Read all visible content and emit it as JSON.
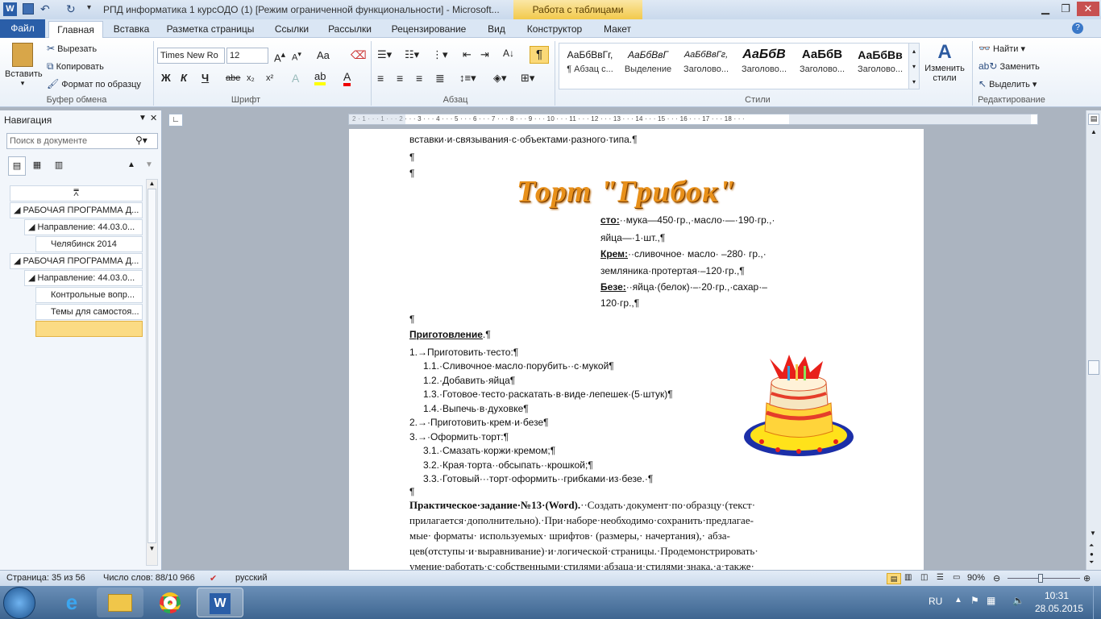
{
  "titlebar": {
    "title": "РПД информатика 1 курсОДО (1) [Режим ограниченной функциональности]  -  Microsoft...",
    "context_tab": "Работа с таблицами"
  },
  "tabs": [
    "Файл",
    "Главная",
    "Вставка",
    "Разметка страницы",
    "Ссылки",
    "Рассылки",
    "Рецензирование",
    "Вид",
    "Конструктор",
    "Макет"
  ],
  "ribbon": {
    "clipboard": {
      "paste": "Вставить",
      "cut": "Вырезать",
      "copy": "Копировать",
      "format_painter": "Формат по образцу",
      "label": "Буфер обмена"
    },
    "font": {
      "name": "Times New Ro",
      "size": "12",
      "label": "Шрифт",
      "bold": "Ж",
      "italic": "К",
      "underline": "Ч",
      "strike": "abe",
      "sub": "x₂",
      "sup": "x²",
      "case": "Aa"
    },
    "paragraph": {
      "label": "Абзац",
      "pilcrow": "¶"
    },
    "styles": {
      "label": "Стили",
      "items": [
        {
          "sample": "АаБбВвГг,",
          "name": "¶ Абзац с..."
        },
        {
          "sample": "АаБбВвГ",
          "name": "Выделение"
        },
        {
          "sample": "АаБбВвГг,",
          "name": "Заголово..."
        },
        {
          "sample": "АаБбВ",
          "name": "Заголово..."
        },
        {
          "sample": "АаБбВ",
          "name": "Заголово..."
        },
        {
          "sample": "АаБбВв",
          "name": "Заголово..."
        }
      ],
      "change": "Изменить стили"
    },
    "editing": {
      "find": "Найти",
      "replace": "Заменить",
      "select": "Выделить",
      "label": "Редактирование"
    }
  },
  "nav": {
    "title": "Навигация",
    "search_placeholder": "Поиск в документе",
    "items": [
      "РАБОЧАЯ ПРОГРАММА Д...",
      "Направление: 44.03.0...",
      "Челябинск 2014",
      "РАБОЧАЯ ПРОГРАММА Д...",
      "Направление: 44.03.0...",
      "Контрольные вопр...",
      "Темы для самостоя..."
    ]
  },
  "ruler": {
    "marks": "2 · 1 · · · 1 · · · 2 · · · 3 · · · 4 · · · 5 · · · 6 · · · 7 · · · 8 · · · 9 · · · 10 · · · 11 · · · 12 · · · 13 · · · 14 · · · 15 · · · 16 · · · 17 · · · 18 · · ·"
  },
  "doc": {
    "line1": "вставки·и·связывания·с·объектами·разного·типа.¶",
    "p1": "¶",
    "p2": "¶",
    "wordart": "Торт \"Грибок\"",
    "r1a": "сто:",
    "r1b": "··мука—450·гр.,·масло·—·190·гр.,·",
    "r2": "яйца—·1·шт.,¶",
    "r3a": "Крем:",
    "r3b": "··сливочное· масло· –280· гр.,·",
    "r4": "земляника·протертая·–120·гр.,¶",
    "r5a": "Безе:",
    "r5b": "··яйца·(белок)·–·20·гр.,·сахар·–",
    "r6": "120·гр.,¶",
    "p3": "¶",
    "prep": "Приготовление",
    "prep_end": ".¶",
    "steps": [
      "1.→Приготовить·тесто:¶",
      "1.1.·Сливочное·масло·порубить··с·мукой¶",
      "1.2.·Добавить·яйца¶",
      "1.3.·Готовое·тесто·раскатать·в·виде·лепешек·(5·штук)¶",
      "1.4.·Выпечь·в·духовке¶",
      "2.→·Приготовить·крем·и·безе¶",
      "3.→·Оформить·торт:¶",
      "3.1.·Смазать·коржи·кремом;¶",
      "3.2.·Края·торта··обсыпать··крошкой;¶",
      "3.3.·Готовый···торт·оформить··грибками·из·безе.·¶"
    ],
    "p4": "¶",
    "task_bold": "Практическое·задание·№13·(Word).",
    "task_l1": "··Создать·документ·по·образцу·(текст·",
    "task_l2": "прилагается·дополнительно).·При·наборе·необходимо·сохранить·предлагае-",
    "task_l3": "мые· форматы· используемых· шрифтов· (размеры,· начертания),· абза-",
    "task_l4": "цев(отступы·и·выравнивание)·и·логической·страницы.·Продемонстрировать·",
    "task_l5": "умение·работать·с·собственными·стилями·абзаца·и·стилями·знака,·а·также·"
  },
  "status": {
    "page": "Страница: 35 из 56",
    "words": "Число слов: 88/10 966",
    "lang": "русский",
    "zoom": "90%"
  },
  "taskbar": {
    "lang": "RU",
    "time": "10:31",
    "date": "28.05.2015"
  },
  "colors": {
    "accent": "#2a5ea8",
    "context": "#f2c94c"
  }
}
